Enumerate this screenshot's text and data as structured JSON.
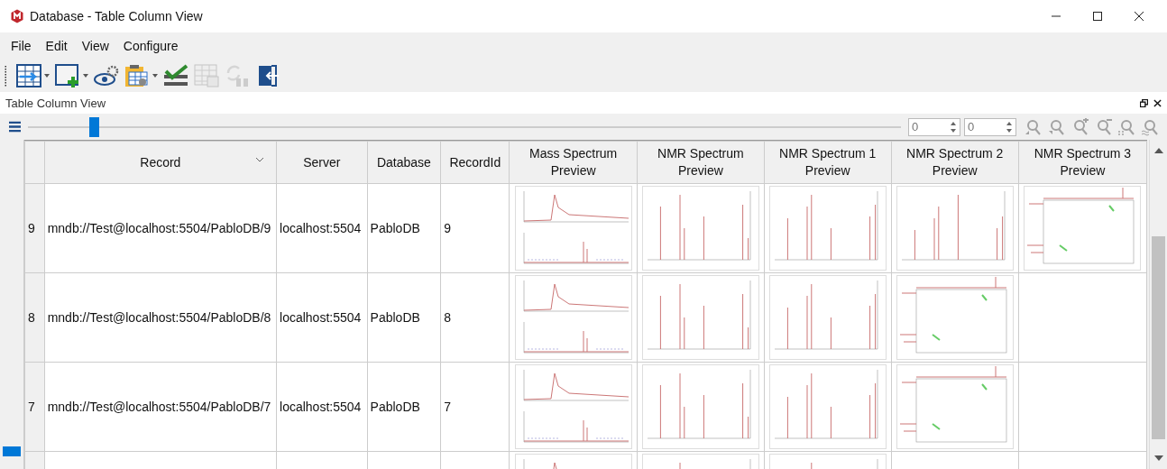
{
  "window": {
    "title": "Database - Table Column View"
  },
  "menu": [
    "File",
    "Edit",
    "View",
    "Configure"
  ],
  "toolbar": [
    {
      "kind": "table-arrow",
      "dropdown": true,
      "disabled": false
    },
    {
      "kind": "new-window",
      "dropdown": true,
      "disabled": false
    },
    {
      "kind": "eye-gear",
      "dropdown": false,
      "disabled": false
    },
    {
      "kind": "clipboard-gear",
      "dropdown": true,
      "disabled": false
    },
    {
      "kind": "check",
      "dropdown": false,
      "disabled": false
    },
    {
      "kind": "table-save",
      "dropdown": false,
      "disabled": true
    },
    {
      "kind": "refresh",
      "dropdown": false,
      "disabled": true
    },
    {
      "kind": "exit",
      "dropdown": false,
      "disabled": false
    }
  ],
  "panel": {
    "title": "Table Column View"
  },
  "zoom_slider": {
    "level": 0.07
  },
  "spinners": [
    {
      "value": "0"
    },
    {
      "value": "0"
    }
  ],
  "zoom_tools": [
    {
      "kind": "prev",
      "disabled": true
    },
    {
      "kind": "next",
      "disabled": true
    },
    {
      "kind": "zoom-in",
      "disabled": true
    },
    {
      "kind": "zoom-out",
      "disabled": true
    },
    {
      "kind": "fit",
      "disabled": true
    },
    {
      "kind": "approx",
      "disabled": true
    }
  ],
  "table": {
    "columns": [
      {
        "label": "Record",
        "sortable": true
      },
      {
        "label": "Server",
        "sortable": false
      },
      {
        "label": "Database",
        "sortable": false
      },
      {
        "label": "RecordId",
        "sortable": false
      },
      {
        "label": "Mass Spectrum Preview",
        "sortable": false
      },
      {
        "label": "NMR Spectrum Preview",
        "sortable": false
      },
      {
        "label": "NMR Spectrum 1 Preview",
        "sortable": false
      },
      {
        "label": "NMR Spectrum 2 Preview",
        "sortable": false
      },
      {
        "label": "NMR Spectrum 3 Preview",
        "sortable": false
      }
    ],
    "rows": [
      {
        "header": "9",
        "record": "mndb://Test@localhost:5504/PabloDB/9",
        "server": "localhost:5504",
        "database": "PabloDB",
        "record_id": "9",
        "previews": [
          {
            "kind": "mass"
          },
          {
            "kind": "nmr-1d"
          },
          {
            "kind": "nmr-1d"
          },
          {
            "kind": "nmr-1d"
          },
          {
            "kind": "nmr-2d"
          }
        ]
      },
      {
        "header": "8",
        "record": "mndb://Test@localhost:5504/PabloDB/8",
        "server": "localhost:5504",
        "database": "PabloDB",
        "record_id": "8",
        "previews": [
          {
            "kind": "mass"
          },
          {
            "kind": "nmr-1d"
          },
          {
            "kind": "nmr-1d"
          },
          {
            "kind": "nmr-2d"
          },
          {
            "kind": "empty"
          }
        ]
      },
      {
        "header": "7",
        "record": "mndb://Test@localhost:5504/PabloDB/7",
        "server": "localhost:5504",
        "database": "PabloDB",
        "record_id": "7",
        "previews": [
          {
            "kind": "mass"
          },
          {
            "kind": "nmr-1d"
          },
          {
            "kind": "nmr-1d"
          },
          {
            "kind": "nmr-2d"
          },
          {
            "kind": "empty"
          }
        ]
      },
      {
        "previews": [
          {
            "kind": "mass"
          },
          {
            "kind": "nmr-1d"
          },
          {
            "kind": "nmr-1d"
          },
          {
            "kind": "empty"
          },
          {
            "kind": "empty"
          }
        ]
      }
    ]
  }
}
